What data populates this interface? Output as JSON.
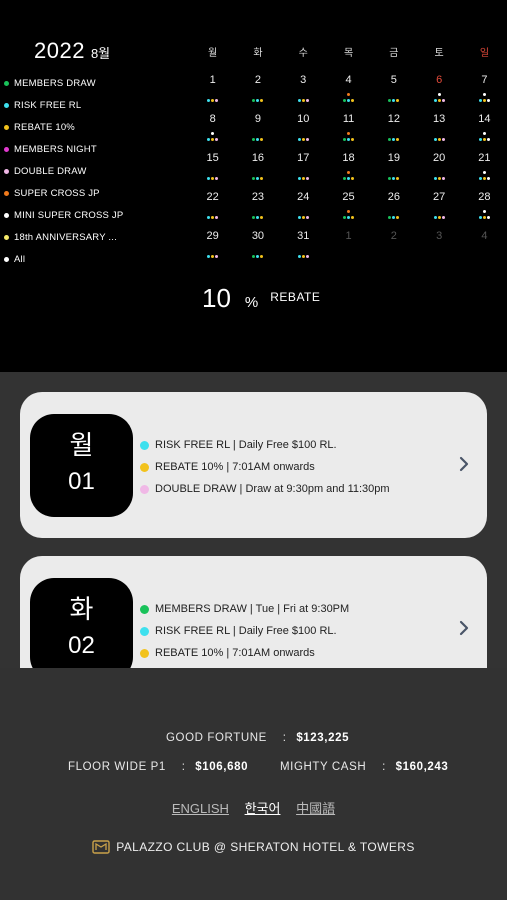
{
  "header": {
    "year": "2022",
    "month": "8월"
  },
  "colors": {
    "green": "#19c25a",
    "cyan": "#3ee0ee",
    "yellow": "#f2c21c",
    "magenta": "#e23ad0",
    "pink": "#f0b8e6",
    "orange": "#f07a1c",
    "white": "#ffffff",
    "lightyellow": "#f6ea6a",
    "red": "#e24a3a"
  },
  "legend": [
    {
      "label": "MEMBERS DRAW",
      "color": "green"
    },
    {
      "label": "RISK FREE RL",
      "color": "cyan"
    },
    {
      "label": "REBATE 10%",
      "color": "yellow"
    },
    {
      "label": "MEMBERS NIGHT",
      "color": "magenta"
    },
    {
      "label": "DOUBLE DRAW",
      "color": "pink"
    },
    {
      "label": "SUPER CROSS JP",
      "color": "orange"
    },
    {
      "label": "MINI SUPER CROSS JP",
      "color": "white"
    },
    {
      "label": "18th ANNIVERSARY ...",
      "color": "lightyellow"
    },
    {
      "label": "All",
      "color": "white"
    }
  ],
  "calendar": {
    "weekdays": [
      "월",
      "화",
      "수",
      "목",
      "금",
      "토",
      "일"
    ],
    "sunday_weekday_index": 6,
    "days": [
      {
        "n": "1",
        "dots": [
          [
            "cyan",
            "yellow",
            "pink"
          ]
        ]
      },
      {
        "n": "2",
        "dots": [
          [
            "green",
            "cyan",
            "yellow"
          ]
        ]
      },
      {
        "n": "3",
        "dots": [
          [
            "cyan",
            "yellow",
            "pink"
          ]
        ]
      },
      {
        "n": "4",
        "dots": [
          [
            "orange"
          ],
          [
            "green",
            "cyan",
            "yellow"
          ]
        ]
      },
      {
        "n": "5",
        "dots": [
          [
            "green",
            "cyan",
            "yellow"
          ]
        ]
      },
      {
        "n": "6",
        "red": true,
        "dots": [
          [
            "white"
          ],
          [
            "cyan",
            "yellow",
            "pink"
          ]
        ]
      },
      {
        "n": "7",
        "dots": [
          [
            "white"
          ],
          [
            "cyan",
            "yellow",
            "white"
          ]
        ]
      },
      {
        "n": "8",
        "dots": [
          [
            "white"
          ],
          [
            "cyan",
            "yellow",
            "pink"
          ]
        ]
      },
      {
        "n": "9",
        "dots": [
          [
            "green",
            "cyan",
            "yellow"
          ]
        ]
      },
      {
        "n": "10",
        "dots": [
          [
            "cyan",
            "yellow",
            "pink"
          ]
        ]
      },
      {
        "n": "11",
        "dots": [
          [
            "orange"
          ],
          [
            "green",
            "cyan",
            "yellow"
          ]
        ]
      },
      {
        "n": "12",
        "dots": [
          [
            "green",
            "cyan",
            "yellow"
          ]
        ]
      },
      {
        "n": "13",
        "dots": [
          [
            "cyan",
            "yellow",
            "pink"
          ]
        ]
      },
      {
        "n": "14",
        "dots": [
          [
            "white"
          ],
          [
            "cyan",
            "yellow",
            "white"
          ]
        ]
      },
      {
        "n": "15",
        "dots": [
          [
            "cyan",
            "yellow",
            "pink"
          ]
        ]
      },
      {
        "n": "16",
        "dots": [
          [
            "green",
            "cyan",
            "yellow"
          ]
        ]
      },
      {
        "n": "17",
        "dots": [
          [
            "cyan",
            "yellow",
            "pink"
          ]
        ]
      },
      {
        "n": "18",
        "dots": [
          [
            "orange"
          ],
          [
            "green",
            "cyan",
            "yellow"
          ]
        ]
      },
      {
        "n": "19",
        "dots": [
          [
            "green",
            "cyan",
            "yellow"
          ]
        ]
      },
      {
        "n": "20",
        "dots": [
          [
            "cyan",
            "yellow",
            "pink"
          ]
        ]
      },
      {
        "n": "21",
        "dots": [
          [
            "white"
          ],
          [
            "cyan",
            "yellow",
            "white"
          ]
        ]
      },
      {
        "n": "22",
        "dots": [
          [
            "cyan",
            "yellow",
            "pink"
          ]
        ]
      },
      {
        "n": "23",
        "dots": [
          [
            "green",
            "cyan",
            "yellow"
          ]
        ]
      },
      {
        "n": "24",
        "dots": [
          [
            "cyan",
            "yellow",
            "pink"
          ]
        ]
      },
      {
        "n": "25",
        "dots": [
          [
            "orange"
          ],
          [
            "green",
            "cyan",
            "yellow"
          ]
        ]
      },
      {
        "n": "26",
        "dots": [
          [
            "green",
            "cyan",
            "yellow"
          ]
        ]
      },
      {
        "n": "27",
        "dots": [
          [
            "cyan",
            "yellow",
            "pink"
          ]
        ]
      },
      {
        "n": "28",
        "dots": [
          [
            "white"
          ],
          [
            "cyan",
            "yellow",
            "white"
          ]
        ]
      },
      {
        "n": "29",
        "dots": [
          [
            "cyan",
            "yellow",
            "pink"
          ]
        ]
      },
      {
        "n": "30",
        "dots": [
          [
            "green",
            "cyan",
            "yellow"
          ]
        ]
      },
      {
        "n": "31",
        "dots": [
          [
            "cyan",
            "yellow",
            "pink"
          ]
        ]
      },
      {
        "n": "1",
        "out": true,
        "dots": []
      },
      {
        "n": "2",
        "out": true,
        "dots": []
      },
      {
        "n": "3",
        "out": true,
        "dots": []
      },
      {
        "n": "4",
        "out": true,
        "dots": []
      }
    ]
  },
  "rebate": {
    "value": "10",
    "unit": "%",
    "label": "REBATE"
  },
  "cards": [
    {
      "weekday": "월",
      "day": "01",
      "events": [
        {
          "color": "cyan",
          "text": "RISK FREE RL | Daily Free $100 RL."
        },
        {
          "color": "yellow",
          "text": "REBATE 10% | 7:01AM onwards"
        },
        {
          "color": "pink",
          "text": "DOUBLE DRAW | Draw at 9:30pm and 11:30pm"
        }
      ]
    },
    {
      "weekday": "화",
      "day": "02",
      "events": [
        {
          "color": "green",
          "text": "MEMBERS DRAW | Tue | Fri  at 9:30PM"
        },
        {
          "color": "cyan",
          "text": "RISK FREE RL | Daily Free $100 RL."
        },
        {
          "color": "yellow",
          "text": "REBATE 10% | 7:01AM onwards"
        }
      ]
    }
  ],
  "jackpots": {
    "good_fortune": {
      "label": "GOOD FORTUNE",
      "sep": ":",
      "value": "$123,225"
    },
    "floor_wide": {
      "label": "FLOOR WIDE P1",
      "sep": ":",
      "value": "$106,680"
    },
    "mighty_cash": {
      "label": "MIGHTY CASH",
      "sep": ":",
      "value": "$160,243"
    }
  },
  "languages": {
    "english": "ENGLISH",
    "korean": "한국어",
    "chinese": "中國語"
  },
  "brand": {
    "text": "PALAZZO CLUB @ SHERATON HOTEL & TOWERS",
    "logo_icon": "palazzo-logo-icon"
  }
}
